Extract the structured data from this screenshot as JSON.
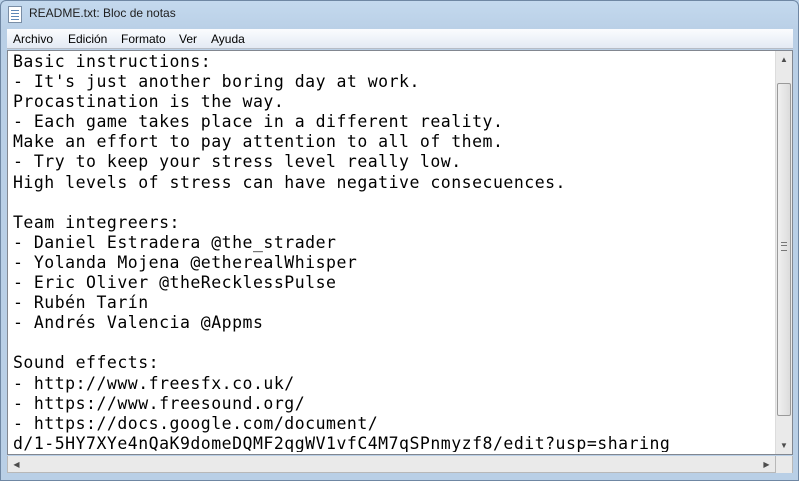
{
  "window": {
    "title": "README.txt: Bloc de notas"
  },
  "menu": [
    "Archivo",
    "Edición",
    "Formato",
    "Ver",
    "Ayuda"
  ],
  "document": {
    "text": "Basic instructions:\n- It's just another boring day at work.\nProcastination is the way.\n- Each game takes place in a different reality.\nMake an effort to pay attention to all of them.\n- Try to keep your stress level really low.\nHigh levels of stress can have negative consecuences.\n\nTeam integreers:\n- Daniel Estradera @the_strader\n- Yolanda Mojena @etherealWhisper\n- Eric Oliver @theRecklessPulse\n- Rubén Tarín\n- Andrés Valencia @Appms\n\nSound effects:\n- http://www.freesfx.co.uk/\n- https://www.freesound.org/\n- https://docs.google.com/document/\nd/1-5HY7XYe4nQaK9domeDQMF2qgWV1vfC4M7qSPnmyzf8/edit?usp=sharing"
  },
  "icons": {
    "app": "notepad-icon",
    "scroll_up": "scroll-up-arrow-icon",
    "scroll_down": "scroll-down-arrow-icon",
    "scroll_left": "scroll-left-arrow-icon",
    "scroll_right": "scroll-right-arrow-icon"
  }
}
